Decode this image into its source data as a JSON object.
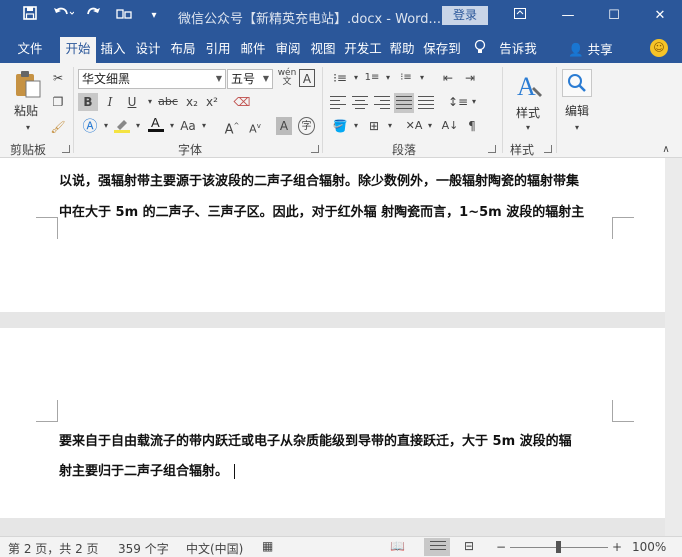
{
  "titlebar": {
    "doc_title": "微信公众号【新精英充电站】.docx - Word...",
    "login": "登录",
    "icons": [
      "save-icon",
      "undo-icon",
      "redo-icon",
      "touch-mode-icon",
      "customize-icon"
    ]
  },
  "tabs": [
    {
      "label": "文件"
    },
    {
      "label": "开始"
    },
    {
      "label": "插入"
    },
    {
      "label": "设计"
    },
    {
      "label": "布局"
    },
    {
      "label": "引用"
    },
    {
      "label": "邮件"
    },
    {
      "label": "审阅"
    },
    {
      "label": "视图"
    },
    {
      "label": "开发工"
    },
    {
      "label": "帮助"
    },
    {
      "label": "保存到"
    },
    {
      "label": "告诉我"
    }
  ],
  "share": "共享",
  "ribbon": {
    "clipboard": {
      "paste": "粘贴",
      "label": "剪贴板"
    },
    "font": {
      "family": "华文细黑",
      "size": "五号",
      "label": "字体",
      "bold": "B",
      "italic": "I",
      "underline": "U",
      "strike": "abc",
      "sub": "x₂",
      "sup": "x²"
    },
    "paragraph": {
      "label": "段落"
    },
    "styles": {
      "label": "样式",
      "button": "样式"
    },
    "editing": {
      "button": "编辑"
    }
  },
  "document": {
    "page1_lines": [
      "以说，强辐射带主要源于该波段的二声子组合辐射。除少数例外，一般辐射陶瓷的辐射带集",
      "中在大于 5m 的二声子、三声子区。因此，对于红外辐 射陶瓷而言，1~5m 波段的辐射主"
    ],
    "page2_lines": [
      "要来自于自由载流子的带内跃迁或电子从杂质能级到导带的直接跃迁，大于 5m 波段的辐",
      "射主要归于二声子组合辐射。"
    ]
  },
  "status": {
    "page": "第 2 页，共 2 页",
    "words": "359 个字",
    "lang": "中文(中国)",
    "zoom": "100%",
    "minus": "−",
    "plus": "+"
  }
}
